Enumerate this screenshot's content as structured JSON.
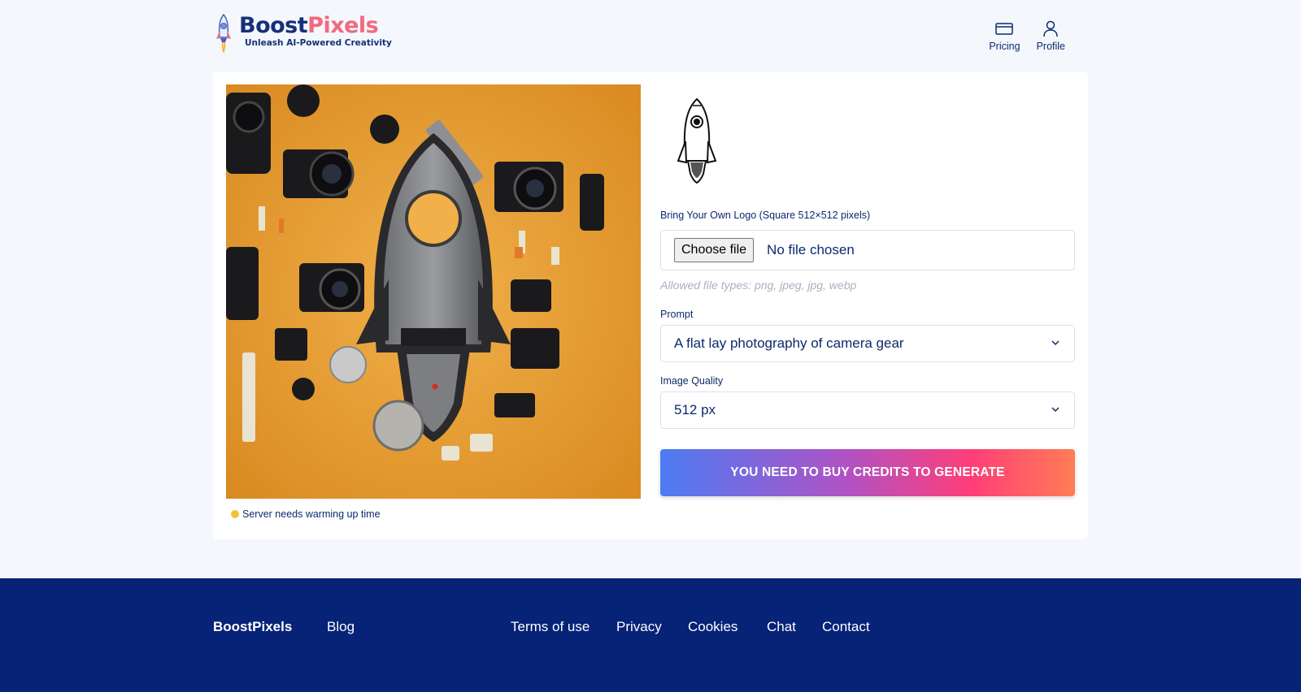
{
  "header": {
    "brand_part1": "Boost",
    "brand_part2": "Pixels",
    "tagline": "Unleash AI-Powered Creativity",
    "nav": [
      {
        "label": "Pricing",
        "icon": "credit-card-icon"
      },
      {
        "label": "Profile",
        "icon": "user-icon"
      }
    ]
  },
  "generator": {
    "status_text": "Server needs warming up time",
    "status_color": "#f5c03a",
    "logo_label": "Bring Your Own Logo (Square 512×512 pixels)",
    "file_button": "Choose file",
    "file_status": "No file chosen",
    "file_hint": "Allowed file types: png, jpeg, jpg, webp",
    "prompt_label": "Prompt",
    "prompt_value": "A flat lay photography of camera gear",
    "quality_label": "Image Quality",
    "quality_value": "512 px",
    "cta_label": "YOU NEED TO BUY CREDITS TO GENERATE"
  },
  "footer": {
    "brand": "BoostPixels",
    "links": [
      "Blog",
      "Terms of use",
      "Privacy",
      "Cookies",
      "Chat",
      "Contact"
    ]
  },
  "colors": {
    "navy": "#062377",
    "brand_pink": "#f06a7e",
    "background": "#f4f7fc"
  }
}
